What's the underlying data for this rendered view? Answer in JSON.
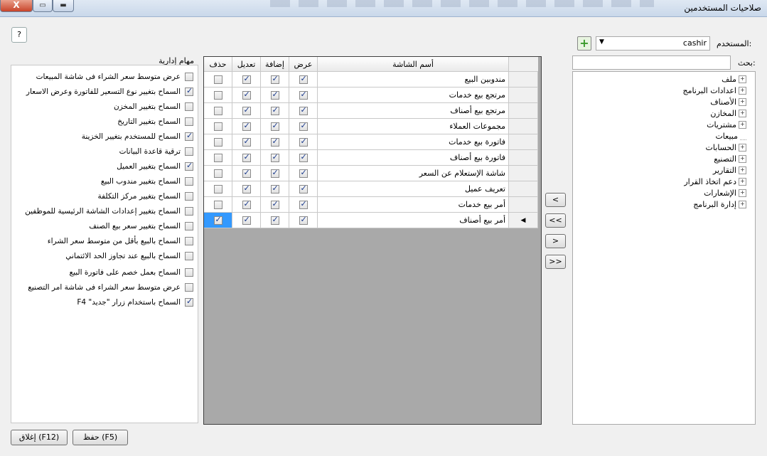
{
  "window": {
    "title": "صلاحيات المستخدمين",
    "close_glyph": "X",
    "max_glyph": "▭",
    "min_glyph": "▬"
  },
  "help": {
    "label": "?"
  },
  "user": {
    "label": "المستخدم:",
    "value": "cashir",
    "dropdown_glyph": "▼",
    "add_glyph": "+"
  },
  "search": {
    "label": "بحث:",
    "value": ""
  },
  "tree": [
    {
      "label": "ملف",
      "expand": "+"
    },
    {
      "label": "اعدادات البرنامج",
      "expand": "+"
    },
    {
      "label": "الأصناف",
      "expand": "+"
    },
    {
      "label": "المخازن",
      "expand": "+"
    },
    {
      "label": "مشتريات",
      "expand": "+"
    },
    {
      "label": "مبيعات",
      "expand": ""
    },
    {
      "label": "الحسابات",
      "expand": "+"
    },
    {
      "label": "التصنيع",
      "expand": "+"
    },
    {
      "label": "التقارير",
      "expand": "+"
    },
    {
      "label": "دعم اتخاذ القرار",
      "expand": "+"
    },
    {
      "label": "الإشعارات",
      "expand": "+"
    },
    {
      "label": "إدارة البرنامج",
      "expand": "+"
    }
  ],
  "arrows": [
    "<",
    "<<",
    ">",
    ">>"
  ],
  "grid": {
    "columns": [
      "أسم الشاشة",
      "عرض",
      "إضافة",
      "تعديل",
      "حذف"
    ],
    "current_row_glyph": "◀",
    "rows": [
      {
        "name": "مندوبين البيع",
        "view": true,
        "add": true,
        "edit": true,
        "delete": false
      },
      {
        "name": "مرتجع بيع خدمات",
        "view": true,
        "add": true,
        "edit": true,
        "delete": false
      },
      {
        "name": "مرتجع بيع أصناف",
        "view": true,
        "add": true,
        "edit": true,
        "delete": false
      },
      {
        "name": "مجموعات العملاء",
        "view": true,
        "add": true,
        "edit": true,
        "delete": false
      },
      {
        "name": "فاتورة بيع خدمات",
        "view": true,
        "add": true,
        "edit": true,
        "delete": false
      },
      {
        "name": "فاتورة بيع أصناف",
        "view": true,
        "add": true,
        "edit": true,
        "delete": false
      },
      {
        "name": "شاشة الإستعلام عن السعر",
        "view": true,
        "add": true,
        "edit": true,
        "delete": false
      },
      {
        "name": "تعريف عميل",
        "view": true,
        "add": true,
        "edit": true,
        "delete": false
      },
      {
        "name": "أمر بيع خدمات",
        "view": true,
        "add": true,
        "edit": true,
        "delete": false
      },
      {
        "name": "أمر بيع أصناف",
        "view": true,
        "add": true,
        "edit": true,
        "delete": true
      }
    ]
  },
  "admin": {
    "title": "مهام إدارية",
    "items": [
      {
        "label": "عرض متوسط سعر الشراء فى شاشة المبيعات",
        "checked": false
      },
      {
        "label": "السماح بتغيير نوع التسعير للفاتورة وعرض الاسعار",
        "checked": true
      },
      {
        "label": "السماح بتغيير المخزن",
        "checked": false
      },
      {
        "label": "السماح بتغيير التاريخ",
        "checked": false
      },
      {
        "label": "السماح للمستخدم بتغيير الخزينة",
        "checked": true
      },
      {
        "label": "ترقية قاعدة البيانات",
        "checked": false
      },
      {
        "label": "السماح بتغيير العميل",
        "checked": true
      },
      {
        "label": "السماح بتغيير مندوب البيع",
        "checked": false
      },
      {
        "label": "السماح بتغيير مركز التكلفة",
        "checked": false
      },
      {
        "label": "السماح بتغيير إعدادات الشاشة الرئيسية للموظفين",
        "checked": false
      },
      {
        "label": "السماح بتغيير سعر بيع الصنف",
        "checked": false
      },
      {
        "label": "السماح بالبيع بأقل من متوسط سعر الشراء",
        "checked": false
      },
      {
        "label": "السماح بالبيع عند تجاوز الحد الائتماني",
        "checked": false
      },
      {
        "label": "السماح بعمل خصم على فاتورة البيع",
        "checked": false
      },
      {
        "label": "عرض متوسط سعر الشراء فى شاشة امر التصنيع",
        "checked": false
      },
      {
        "label": "السماح باستخدام زرار \"جديد\" F4",
        "checked": true
      }
    ]
  },
  "buttons": {
    "save": "حفظ (F5)",
    "close": "إغلاق (F12)"
  }
}
